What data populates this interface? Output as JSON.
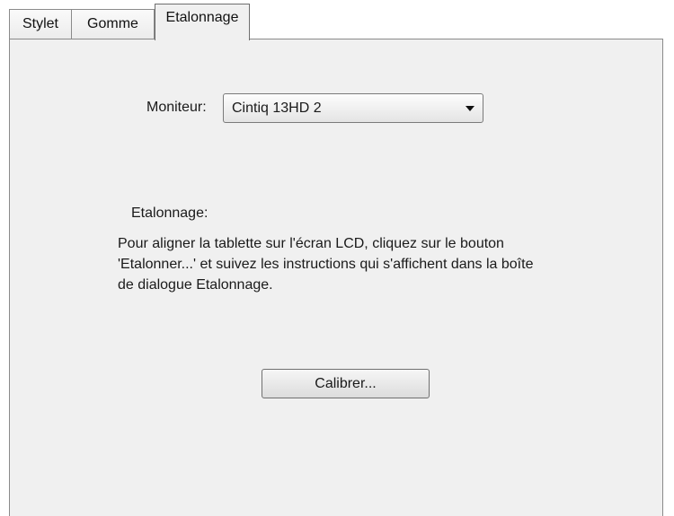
{
  "tabs": [
    {
      "label": "Stylet",
      "active": false
    },
    {
      "label": "Gomme",
      "active": false
    },
    {
      "label": "Etalonnage",
      "active": true
    }
  ],
  "monitor": {
    "label": "Moniteur:",
    "selected": "Cintiq 13HD 2"
  },
  "calibration": {
    "section_label": "Etalonnage:",
    "description_lines": [
      "Pour aligner la tablette sur l'écran LCD, cliquez sur le bouton",
      "'Etalonner...' et suivez les instructions qui s'affichent dans la boîte",
      "de dialogue Etalonnage."
    ],
    "button_label": "Calibrer..."
  }
}
